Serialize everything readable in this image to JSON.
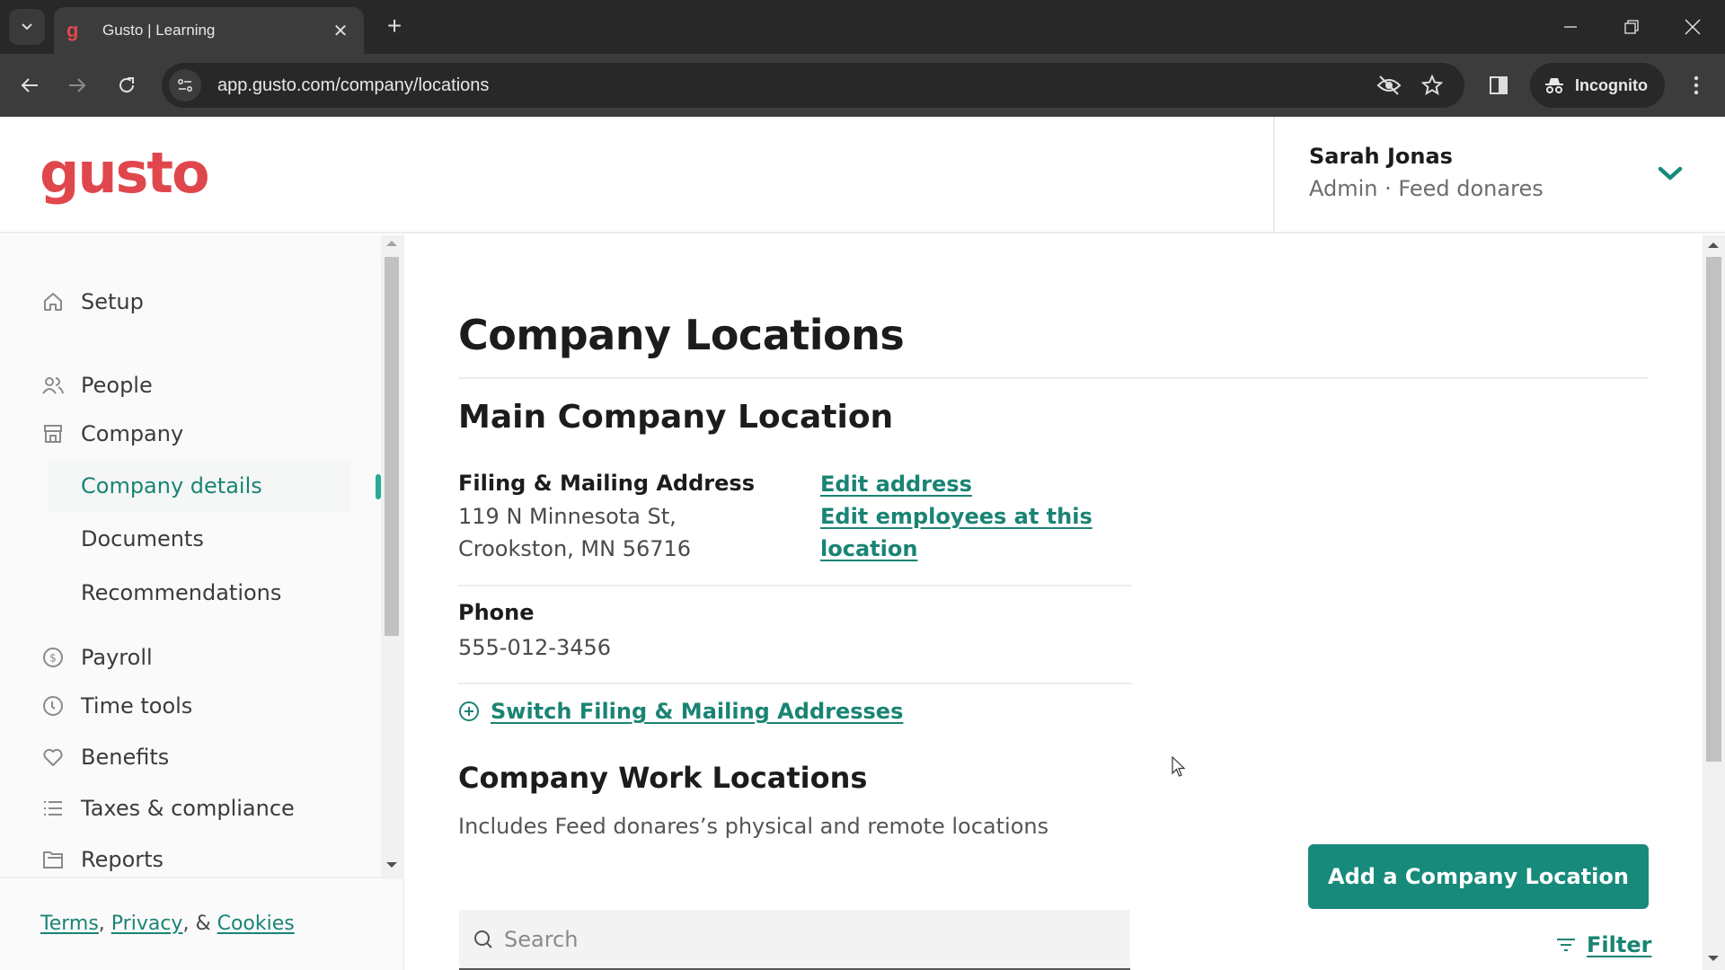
{
  "browser": {
    "tab_title": "Gusto | Learning",
    "favicon_letter": "g",
    "url": "app.gusto.com/company/locations",
    "incognito_label": "Incognito"
  },
  "header": {
    "logo": "gusto",
    "user_name": "Sarah Jonas",
    "user_role": "Admin · Feed donares"
  },
  "sidebar": {
    "items": [
      {
        "label": "Setup",
        "icon": "home-icon"
      },
      {
        "label": "People",
        "icon": "people-icon"
      },
      {
        "label": "Company",
        "icon": "store-icon"
      },
      {
        "label": "Payroll",
        "icon": "dollar-circle-icon"
      },
      {
        "label": "Time tools",
        "icon": "clock-icon"
      },
      {
        "label": "Benefits",
        "icon": "heart-icon"
      },
      {
        "label": "Taxes & compliance",
        "icon": "list-icon"
      },
      {
        "label": "Reports",
        "icon": "folder-icon"
      }
    ],
    "company_subitems": [
      {
        "label": "Company details",
        "active": true
      },
      {
        "label": "Documents",
        "active": false
      },
      {
        "label": "Recommendations",
        "active": false
      }
    ],
    "footer": {
      "terms": "Terms",
      "sep1": ",",
      "privacy": "Privacy",
      "sep2": ", &",
      "cookies": "Cookies"
    }
  },
  "main": {
    "page_title": "Company Locations",
    "main_location": {
      "title": "Main Company Location",
      "address_label": "Filing & Mailing Address",
      "address_line1": "119 N Minnesota St,",
      "address_line2": "Crookston, MN 56716",
      "edit_address": "Edit address",
      "edit_employees_line1": "Edit employees at this",
      "edit_employees_line2": "location",
      "phone_label": "Phone",
      "phone_value": "555-012-3456",
      "switch_link": "Switch Filing & Mailing Addresses"
    },
    "work_locations": {
      "title": "Company Work Locations",
      "subtitle": "Includes Feed donares’s physical and remote locations",
      "add_button": "Add a Company Location",
      "search_placeholder": "Search",
      "search_value": "",
      "filter_label": "Filter"
    }
  },
  "colors": {
    "brand": "#e0474c",
    "accent": "#1a8474",
    "button": "#178a7b"
  }
}
